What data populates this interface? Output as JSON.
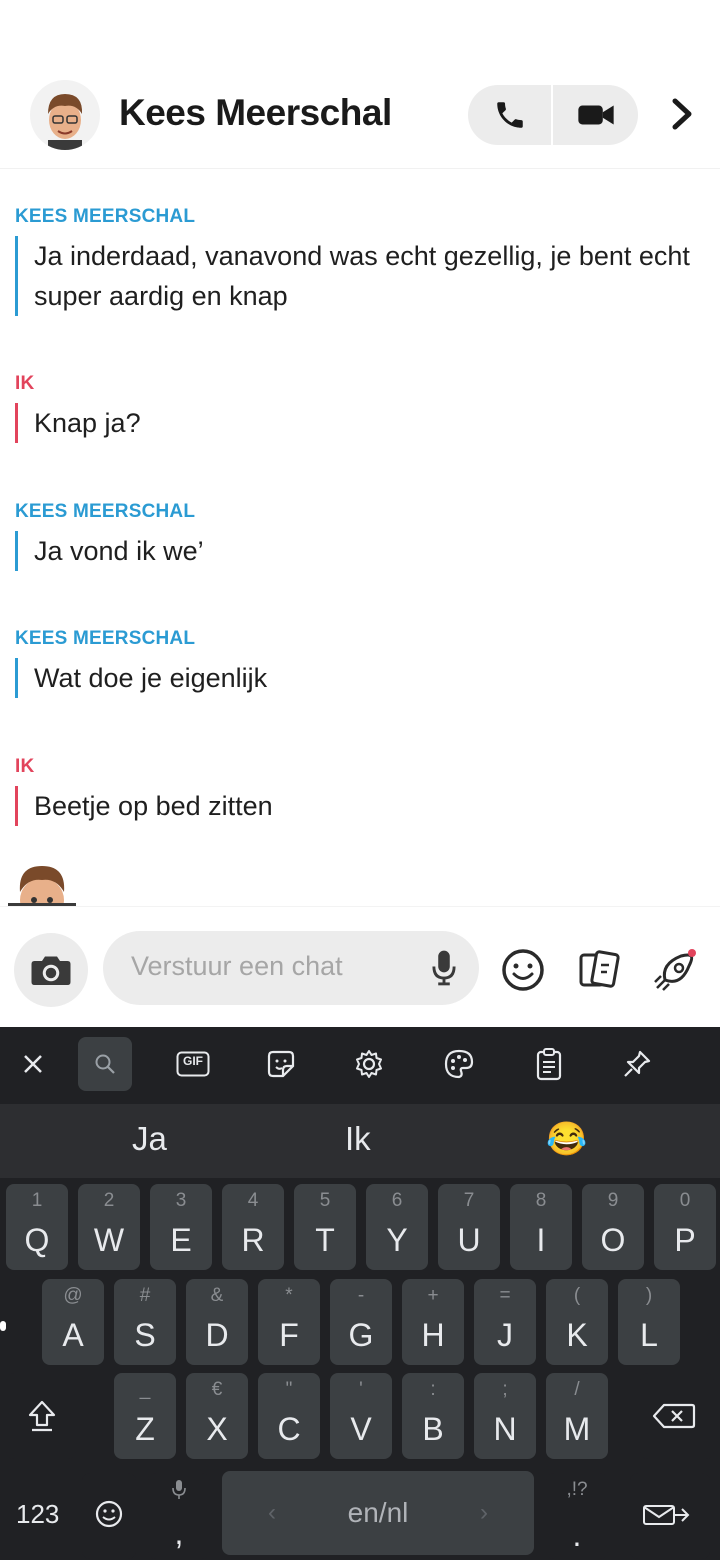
{
  "header": {
    "contact_name": "Kees Meerschal",
    "avatar_icon": "bitmoji-avatar-icon",
    "call_icon": "phone-icon",
    "video_icon": "video-camera-icon",
    "more_icon": "chevron-right-icon"
  },
  "messages": [
    {
      "sender": "KEES MEERSCHAL",
      "text": "Ja inderdaad, vanavond was echt gezellig, je bent echt super aardig en knap"
    },
    {
      "sender": "IK",
      "text": "Knap ja?"
    },
    {
      "sender": "KEES MEERSCHAL",
      "text": "Ja vond ik we’"
    },
    {
      "sender": "KEES MEERSCHAL",
      "text": "Wat doe je eigenlijk"
    },
    {
      "sender": "IK",
      "text": "Beetje op bed zitten"
    }
  ],
  "composer": {
    "placeholder": "Verstuur een chat",
    "camera_icon": "camera-icon",
    "mic_icon": "microphone-icon",
    "emoji_icon": "smiley-icon",
    "stickers_icon": "cards-icon",
    "games_icon": "rocket-icon"
  },
  "keyboard": {
    "toolbar": [
      "close-icon",
      "search-icon",
      "gif-icon",
      "sticker-icon",
      "settings-icon",
      "palette-icon",
      "clipboard-icon",
      "pin-icon"
    ],
    "gif_label": "GIF",
    "suggestions": [
      "Ja",
      "Ik",
      "😂"
    ],
    "row1": [
      {
        "m": "Q",
        "h": "1"
      },
      {
        "m": "W",
        "h": "2"
      },
      {
        "m": "E",
        "h": "3"
      },
      {
        "m": "R",
        "h": "4"
      },
      {
        "m": "T",
        "h": "5"
      },
      {
        "m": "Y",
        "h": "6"
      },
      {
        "m": "U",
        "h": "7"
      },
      {
        "m": "I",
        "h": "8"
      },
      {
        "m": "O",
        "h": "9"
      },
      {
        "m": "P",
        "h": "0"
      }
    ],
    "row2": [
      {
        "m": "A",
        "h": "@"
      },
      {
        "m": "S",
        "h": "#"
      },
      {
        "m": "D",
        "h": "&"
      },
      {
        "m": "F",
        "h": "*"
      },
      {
        "m": "G",
        "h": "-"
      },
      {
        "m": "H",
        "h": "+"
      },
      {
        "m": "J",
        "h": "="
      },
      {
        "m": "K",
        "h": "("
      },
      {
        "m": "L",
        "h": ")"
      }
    ],
    "row3": [
      {
        "m": "Z",
        "h": "_"
      },
      {
        "m": "X",
        "h": "€"
      },
      {
        "m": "C",
        "h": "\""
      },
      {
        "m": "V",
        "h": "'"
      },
      {
        "m": "B",
        "h": ":"
      },
      {
        "m": "N",
        "h": ";"
      },
      {
        "m": "M",
        "h": "/"
      }
    ],
    "numbers_label": "123",
    "comma_label": ",",
    "space_label": "en/nl",
    "period_label": ".",
    "period_hint": ",!?",
    "shift_icon": "shift-icon",
    "backspace_icon": "backspace-icon",
    "enter_icon": "send-icon"
  }
}
